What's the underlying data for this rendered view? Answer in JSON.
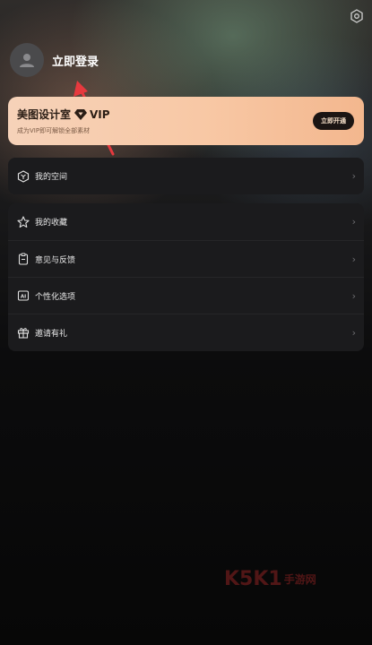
{
  "profile": {
    "login_label": "立即登录"
  },
  "vip": {
    "title": "美图设计室",
    "tag": "VIP",
    "subtitle": "成为VIP即可解锁全部素材",
    "button_label": "立即开通"
  },
  "menu_group_1": [
    {
      "label": "我的空间",
      "icon": "hexagon-space-icon"
    }
  ],
  "menu_group_2": [
    {
      "label": "我的收藏",
      "icon": "star-icon"
    },
    {
      "label": "意见与反馈",
      "icon": "clipboard-icon"
    },
    {
      "label": "个性化选项",
      "icon": "ai-icon"
    },
    {
      "label": "邀请有礼",
      "icon": "gift-icon"
    }
  ],
  "watermark": {
    "logo": "K5K1",
    "text": "手游网"
  },
  "colors": {
    "vip_gradient_start": "#f6d2b9",
    "vip_gradient_end": "#f3b78e",
    "arrow": "#e6393e"
  }
}
